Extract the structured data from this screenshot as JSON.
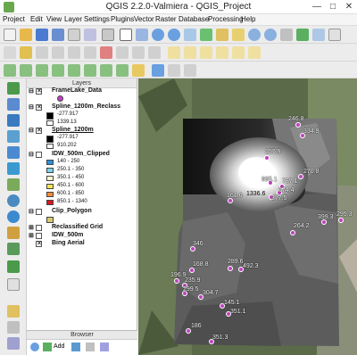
{
  "window": {
    "title": "QGIS 2.2.0-Valmiera - QGIS_Project"
  },
  "menu": [
    "Project",
    "Edit",
    "View",
    "Layer",
    "Settings",
    "Plugins",
    "Vector",
    "Raster",
    "Database",
    "Processing",
    "Help"
  ],
  "layers_panel": {
    "title": "Layers",
    "layers": [
      {
        "name": "FrameLake_Data",
        "checked": true
      },
      {
        "name": "Spline_1200m_Reclass",
        "checked": true,
        "legend": [
          "-277.917",
          "1339.13"
        ]
      },
      {
        "name": "Spline_1200m",
        "checked": true,
        "legend": [
          "-277.917",
          "910.202"
        ]
      },
      {
        "name": "IDW_500m_Clipped",
        "checked": true,
        "classes": [
          {
            "label": "140 - 250",
            "color": "#2f8fd8"
          },
          {
            "label": "250.1 - 350",
            "color": "#7ed3e8"
          },
          {
            "label": "350.1 - 450",
            "color": "#ffffd0"
          },
          {
            "label": "450.1 - 600",
            "color": "#f7e35a"
          },
          {
            "label": "600.1 - 850",
            "color": "#f08c3c"
          },
          {
            "label": "850.1 - 1340",
            "color": "#d7191c"
          }
        ]
      },
      {
        "name": "Clip_Polygon",
        "checked": false
      },
      {
        "name": "Reclassified Grid",
        "checked": false
      },
      {
        "name": "IDW_500m",
        "checked": false
      },
      {
        "name": "Bing Aerial",
        "checked": true
      }
    ]
  },
  "browser_panel": {
    "title": "Browser",
    "add_label": "Add"
  },
  "map": {
    "points": [
      {
        "label": "246.8"
      },
      {
        "label": "334.9"
      },
      {
        "label": "257.9"
      },
      {
        "label": "270.8"
      },
      {
        "label": "695.1"
      },
      {
        "label": "737.1"
      },
      {
        "label": "674.4"
      },
      {
        "label": "1336.6"
      },
      {
        "label": "161.6"
      },
      {
        "label": "377.5"
      },
      {
        "label": "399.3"
      },
      {
        "label": "295.3"
      },
      {
        "label": "264.2"
      },
      {
        "label": "346"
      },
      {
        "label": "168.8"
      },
      {
        "label": "289.6"
      },
      {
        "label": "492.3"
      },
      {
        "label": "196.9"
      },
      {
        "label": "235.9"
      },
      {
        "label": "299.5"
      },
      {
        "label": "304.7"
      },
      {
        "label": "145.1"
      },
      {
        "label": "351.1"
      },
      {
        "label": "186"
      },
      {
        "label": "351.3"
      }
    ]
  }
}
